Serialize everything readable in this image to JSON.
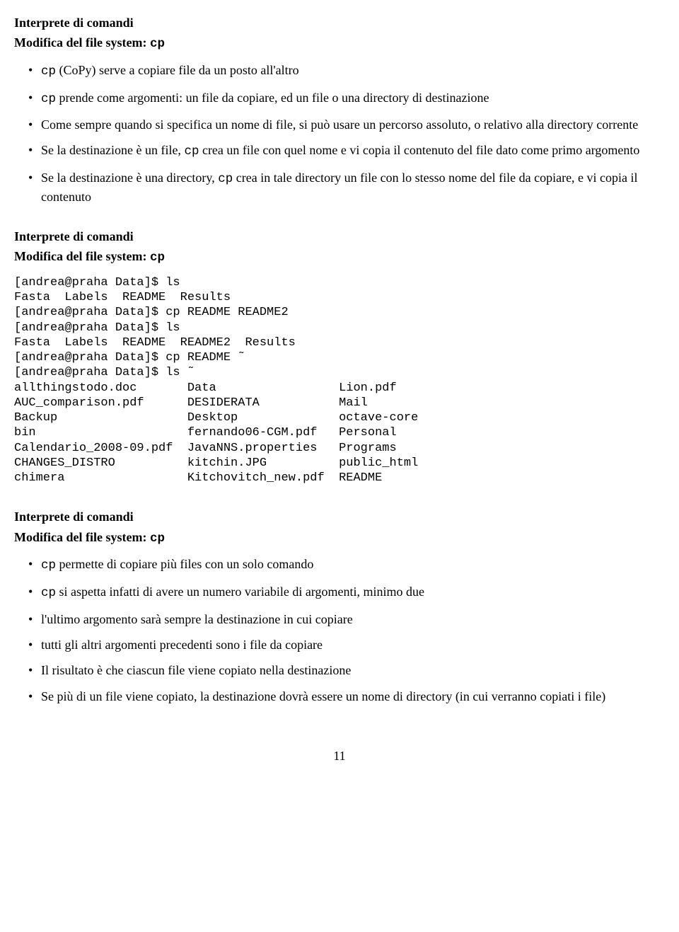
{
  "section1": {
    "title": "Interprete di comandi",
    "subtitle_prefix": "Modifica del file system: ",
    "subtitle_cmd": "cp",
    "bullets": [
      {
        "cmd": "cp",
        "text_before": " (CoPy) serve a copiare file da un posto all'altro"
      },
      {
        "cmd": "cp",
        "text_before": " prende come argomenti: un file da copiare, ed un file o una directory di destinazione"
      },
      {
        "text_before": "Come sempre quando si specifica un nome di file, si può usare un percorso assoluto, o relativo alla directory corrente"
      },
      {
        "text_before": "Se la destinazione è un file, ",
        "cmd": "cp",
        "text_after": " crea un file con quel nome e vi copia il contenuto del file dato come primo argomento"
      },
      {
        "text_before": "Se la destinazione è una directory, ",
        "cmd": "cp",
        "text_after": " crea in tale directory un file con lo stesso nome del file da copiare, e vi copia il contenuto"
      }
    ]
  },
  "section2": {
    "title": "Interprete di comandi",
    "subtitle_prefix": "Modifica del file system: ",
    "subtitle_cmd": "cp",
    "code": "[andrea@praha Data]$ ls\nFasta  Labels  README  Results\n[andrea@praha Data]$ cp README README2\n[andrea@praha Data]$ ls\nFasta  Labels  README  README2  Results\n[andrea@praha Data]$ cp README ˜\n[andrea@praha Data]$ ls ˜\nallthingstodo.doc       Data                 Lion.pdf\nAUC_comparison.pdf      DESIDERATA           Mail\nBackup                  Desktop              octave-core\nbin                     fernando06-CGM.pdf   Personal\nCalendario_2008-09.pdf  JavaNNS.properties   Programs\nCHANGES_DISTRO          kitchin.JPG          public_html\nchimera                 Kitchovitch_new.pdf  README"
  },
  "section3": {
    "title": "Interprete di comandi",
    "subtitle_prefix": "Modifica del file system: ",
    "subtitle_cmd": "cp",
    "bullets": [
      {
        "cmd": "cp",
        "text_before": " permette di copiare più files con un solo comando"
      },
      {
        "cmd": "cp",
        "text_before": " si aspetta infatti di avere un numero variabile di argomenti, minimo due"
      },
      {
        "text_before": "l'ultimo argomento sarà sempre la destinazione in cui copiare"
      },
      {
        "text_before": "tutti gli altri argomenti precedenti sono i file da copiare"
      },
      {
        "text_before": "Il risultato è che ciascun file viene copiato nella destinazione"
      },
      {
        "text_before": "Se più di un file viene copiato, la destinazione dovrà essere un nome di directory (in cui verranno copiati i file)"
      }
    ]
  },
  "page_number": "11"
}
